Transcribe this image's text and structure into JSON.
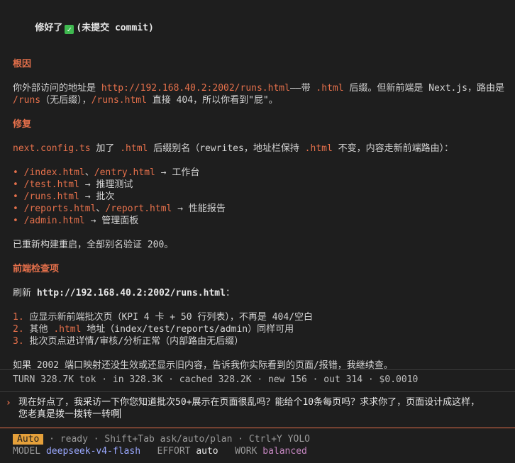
{
  "title": {
    "text": "修好了",
    "check": "✓",
    "note": "(未提交 commit)"
  },
  "cause": {
    "heading": "根因",
    "l1_a": "你外部访问的地址是 ",
    "l1_url": "http://192.168.40.2:2002/runs.html",
    "l1_b": "——带 ",
    "l1_ext": ".html",
    "l1_c": " 后缀。但新前端是 Next.js，路由是",
    "l2_route": "/runs",
    "l2_a": "（无后缀），",
    "l2_html": "/runs.html",
    "l2_b": " 直接 404，所以你看到\"屁\"。"
  },
  "fix": {
    "heading": "修复",
    "intro_file": "next.config.ts",
    "intro_a": " 加了 ",
    "intro_ext": ".html",
    "intro_b": " 后缀别名（rewrites，地址栏保持 ",
    "intro_ext2": ".html",
    "intro_c": " 不变，内容走新前端路由）：",
    "bullet": "•",
    "items": [
      {
        "a": "/index.html",
        "sep": "、",
        "b": "/entry.html",
        "arrow": " → ",
        "target": "工作台"
      },
      {
        "a": "/test.html",
        "arrow": " → ",
        "target": "推理测试"
      },
      {
        "a": "/runs.html",
        "arrow": " → ",
        "target": "批次"
      },
      {
        "a": "/reports.html",
        "sep": "、",
        "b": "/report.html",
        "arrow": " → ",
        "target": "性能报告"
      },
      {
        "a": "/admin.html",
        "arrow": " → ",
        "target": "管理面板"
      }
    ],
    "rebuilt": "已重新构建重启，全部别名验证 200。"
  },
  "check": {
    "heading": "前端检查项",
    "refresh_a": "刷新 ",
    "refresh_url": "http://192.168.40.2:2002/runs.html",
    "refresh_b": "：",
    "items": [
      {
        "num": "1.",
        "text": " 应显示新前端批次页（KPI 4 卡 + 50 行列表），不再是 404/空白"
      },
      {
        "num": "2.",
        "text_a": " 其他 ",
        "code": ".html",
        "text_b": " 地址（index/test/reports/admin）同样可用"
      },
      {
        "num": "3.",
        "text": " 批次页点进详情/审核/分析正常（内部路由无后缀）"
      }
    ],
    "closing": "如果 2002 端口映射还没生效或还显示旧内容，告诉我你实际看到的页面/报错，我继续查。"
  },
  "status": {
    "text": "TURN  328.7K tok · in 328.3K · cached 328.2K · new 156 · out 314 · $0.0010"
  },
  "prompt": {
    "caret": "›",
    "line1": "现在好点了，我采访一下你您知道批次50+展示在页面很乱吗？能给个10条每页吗？求求你了，页面设计成这样，",
    "line2": "您老真是拨一拨转一转啊"
  },
  "footer": {
    "mode": "Auto",
    "hint": " · ready · Shift+Tab ask/auto/plan · Ctrl+Y YOLO",
    "model_label": "MODEL ",
    "model_value": "deepseek-v4-flash",
    "effort_label": "   EFFORT ",
    "effort_value": "auto",
    "work_label": "   WORK ",
    "work_value": "balanced"
  },
  "colors": {
    "background": "#1e1e1e",
    "accent": "#e5704b",
    "check": "#3fb950",
    "badge": "#e5a03a",
    "model": "#9aa8ff",
    "work": "#c586c0"
  }
}
